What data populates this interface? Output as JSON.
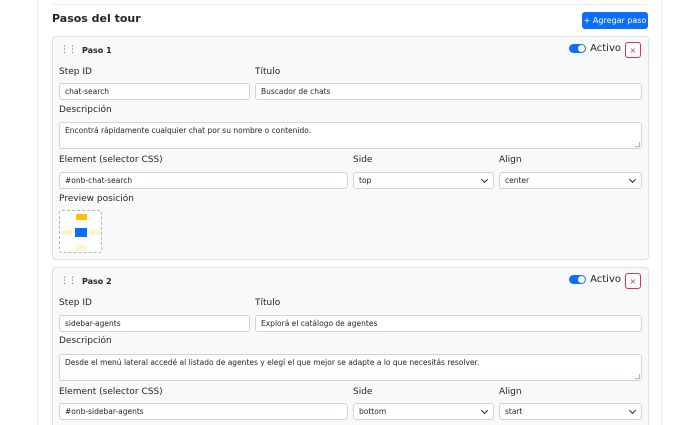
{
  "header": {
    "title": "Pasos del tour",
    "add_label": "+ Agregar paso"
  },
  "labels": {
    "step_id": "Step ID",
    "title": "Título",
    "description": "Descripción",
    "element": "Element (selector CSS)",
    "side": "Side",
    "align": "Align",
    "preview": "Preview posición",
    "active": "Activo",
    "remove": "×",
    "drag": "⋮⋮"
  },
  "steps": [
    {
      "name": "Paso 1",
      "active": true,
      "step_id": "chat-search",
      "title": "Buscador de chats",
      "description": "Encontrá rápidamente cualquier chat por su nombre o contenido.",
      "element": "#onb-chat-search",
      "side": "top",
      "align": "center"
    },
    {
      "name": "Paso 2",
      "active": true,
      "step_id": "sidebar-agents",
      "title": "Explorá el catálogo de agentes",
      "description": "Desde el menú lateral accedé al listado de agentes y elegí el que mejor se adapte a lo que necesitás resolver.",
      "element": "#onb-sidebar-agents",
      "side": "bottom",
      "align": "start"
    }
  ],
  "colors": {
    "primary": "#0d6efd",
    "danger": "#dc3545",
    "preview_active": "#ffc107",
    "preview_inactive": "#fff3cd"
  }
}
